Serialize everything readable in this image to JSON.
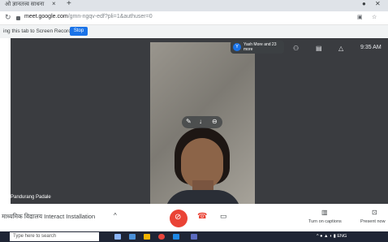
{
  "browser": {
    "tab_title": "ओ ज्ञानतत्त्व साधना",
    "tab_close": "×",
    "new_tab": "+",
    "url_domain": "meet.google.com",
    "url_path": "/gmn-ngqv-edf?pli=1&authuser=0",
    "share_text": "ing this tab to Screen Recorder",
    "stop_label": "Stop"
  },
  "meet": {
    "participant_chip": "Yash More and 23 more",
    "chip_avatar": "Y",
    "clock": "9:35 AM",
    "presenter_name": "Pandurang Padale",
    "meeting_title": "माध्यमिक विद्यालय Interact Installation",
    "captions_label": "Turn on captions",
    "present_label": "Present now"
  },
  "taskbar": {
    "search_placeholder": "Type here to search",
    "tray_text": "ENG"
  },
  "colors": {
    "mic_off": "#ea4335",
    "meet_bg": "#3a3c40",
    "accent": "#1a73e8",
    "taskbar": "#1f2535"
  }
}
